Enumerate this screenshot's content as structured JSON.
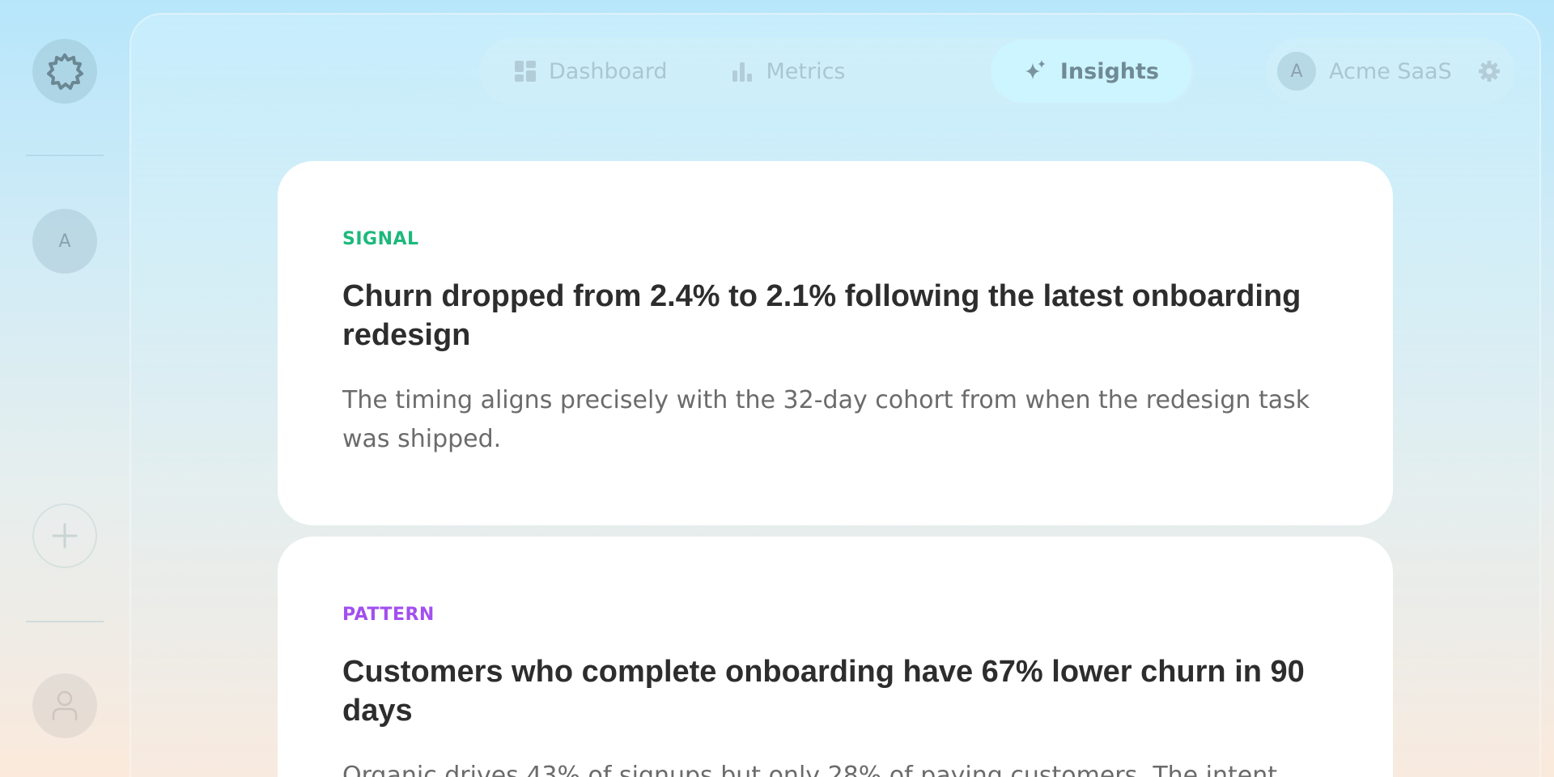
{
  "rail": {
    "avatar_initial": "A"
  },
  "nav": {
    "tabs": [
      {
        "label": "Dashboard",
        "icon": "grid-icon"
      },
      {
        "label": "Metrics",
        "icon": "bar-chart-icon"
      },
      {
        "label": "Insights",
        "icon": "sparkle-icon",
        "active": true
      }
    ]
  },
  "org": {
    "initial": "A",
    "name": "Acme SaaS"
  },
  "insights": [
    {
      "tag": "SIGNAL",
      "tag_color": "#1db97c",
      "title": "Churn dropped from 2.4% to 2.1% following the latest onboarding redesign",
      "body": "The timing aligns precisely with the 32-day cohort from when the redesign task was shipped."
    },
    {
      "tag": "PATTERN",
      "tag_color": "#a24ff0",
      "title": "Customers who complete onboarding have 67% lower churn in 90 days",
      "body": "Organic drives 43% of signups but only 28% of paying customers. The intent"
    }
  ]
}
